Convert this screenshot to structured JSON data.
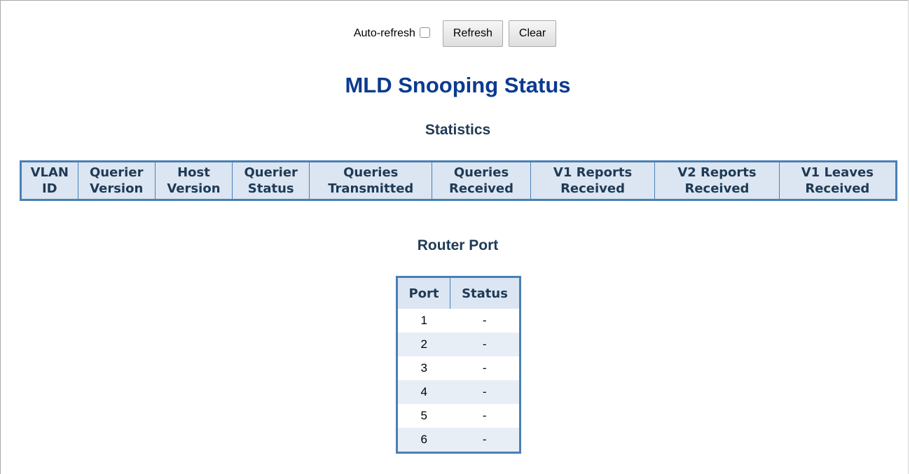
{
  "toolbar": {
    "auto_refresh_label": "Auto-refresh",
    "refresh_label": "Refresh",
    "clear_label": "Clear"
  },
  "page_title": "MLD Snooping Status",
  "statistics": {
    "heading": "Statistics",
    "columns": [
      "VLAN\nID",
      "Querier\nVersion",
      "Host\nVersion",
      "Querier\nStatus",
      "Queries\nTransmitted",
      "Queries\nReceived",
      "V1 Reports\nReceived",
      "V2 Reports\nReceived",
      "V1 Leaves\nReceived"
    ]
  },
  "router_port": {
    "heading": "Router Port",
    "columns": [
      "Port",
      "Status"
    ],
    "rows": [
      {
        "port": "1",
        "status": "-"
      },
      {
        "port": "2",
        "status": "-"
      },
      {
        "port": "3",
        "status": "-"
      },
      {
        "port": "4",
        "status": "-"
      },
      {
        "port": "5",
        "status": "-"
      },
      {
        "port": "6",
        "status": "-"
      }
    ]
  }
}
